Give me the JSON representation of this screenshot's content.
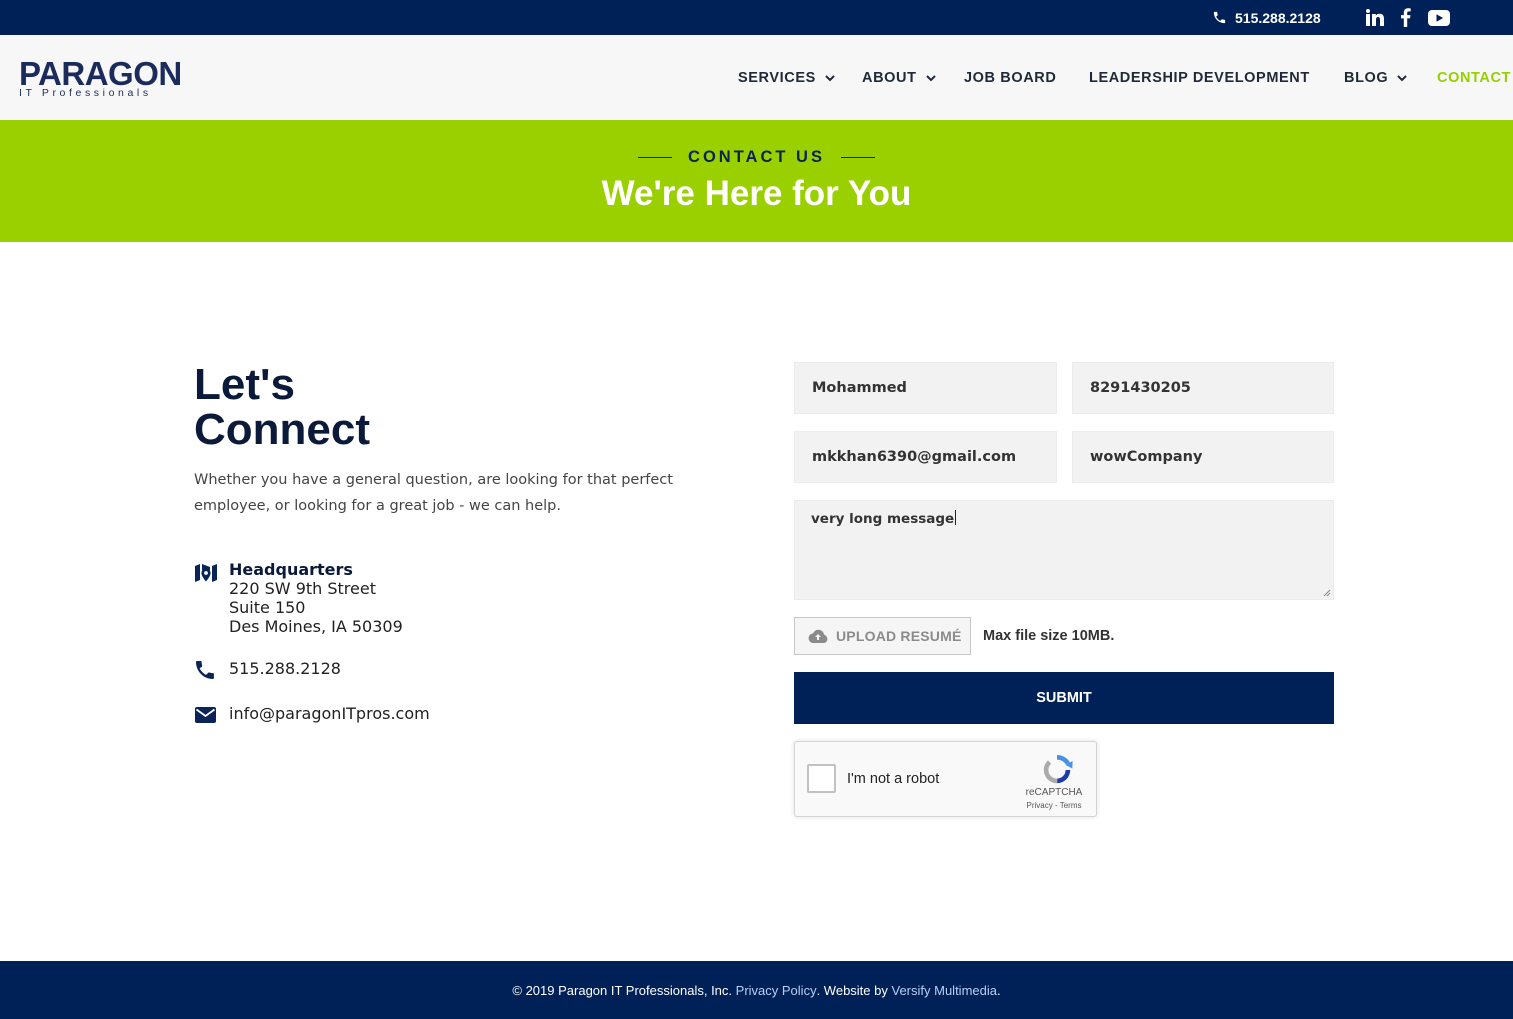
{
  "topbar": {
    "phone": "515.288.2128",
    "social": [
      "linkedin-icon",
      "facebook-icon",
      "youtube-icon"
    ]
  },
  "header": {
    "logo": {
      "word": "PARAGON",
      "sub": "IT Professionals"
    },
    "nav": [
      {
        "label": "SERVICES",
        "dropdown": true
      },
      {
        "label": "ABOUT",
        "dropdown": true
      },
      {
        "label": "JOB BOARD",
        "dropdown": false
      },
      {
        "label": "LEADERSHIP DEVELOPMENT",
        "dropdown": false
      },
      {
        "label": "BLOG",
        "dropdown": true
      },
      {
        "label": "CONTACT",
        "dropdown": false,
        "active": true
      }
    ]
  },
  "banner": {
    "eyebrow": "CONTACT US",
    "headline": "We're Here for You"
  },
  "left": {
    "title_line1": "Let's",
    "title_line2": "Connect",
    "intro": "Whether you have a general question, are looking for that perfect employee, or looking for a great job - we can help.",
    "hq": {
      "title": "Headquarters",
      "line1": "220 SW 9th Street",
      "line2": "Suite 150",
      "line3": "Des Moines, IA 50309"
    },
    "phone": "515.288.2128",
    "email": "info@paragonITpros.com"
  },
  "form": {
    "name": "Mohammed",
    "phone": "8291430205",
    "email": "mkkhan6390@gmail.com",
    "company": "wowCompany",
    "message": "very long message",
    "upload_label": "UPLOAD RESUMÉ",
    "max_size": "Max file size 10MB.",
    "submit_label": "SUBMIT"
  },
  "recaptcha": {
    "label": "I'm not a robot",
    "brand": "reCAPTCHA",
    "terms": "Privacy - Terms"
  },
  "footer": {
    "copyright": "© 2019 Paragon IT Professionals, Inc.",
    "privacy_link": "Privacy Policy",
    "website_by": ". Website by",
    "vendor_link": "Versify Multimedia",
    "end": "."
  },
  "colors": {
    "navy": "#002157",
    "lime": "#9bd000",
    "active_nav": "#96cf00"
  }
}
